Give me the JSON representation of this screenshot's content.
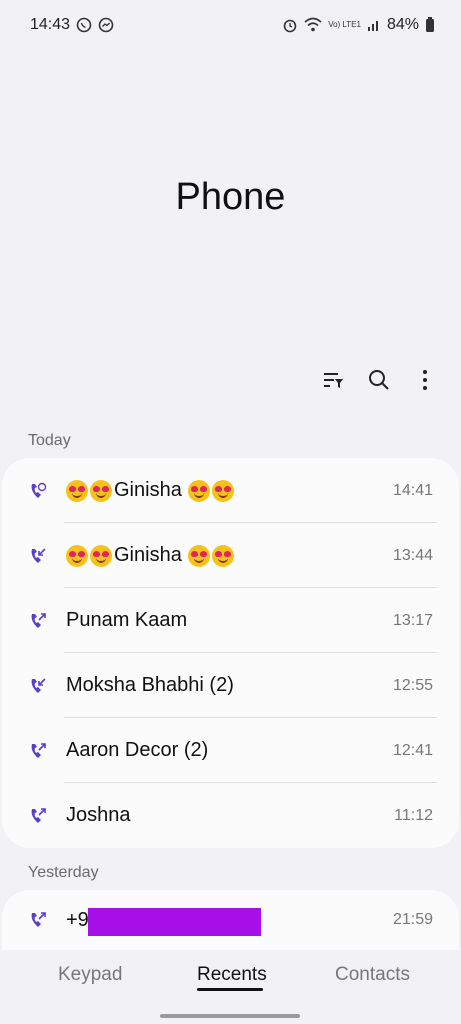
{
  "status_bar": {
    "time": "14:43",
    "battery": "84%",
    "network_label": "Vo) LTE1"
  },
  "header": {
    "title": "Phone"
  },
  "toolbar": {
    "icons": [
      "filter-icon",
      "search-icon",
      "more-options-icon"
    ]
  },
  "sections": [
    {
      "label": "Today",
      "calls": [
        {
          "name": "Ginisha",
          "time": "14:41",
          "type": "video-call",
          "emoji": true
        },
        {
          "name": "Ginisha",
          "time": "13:44",
          "type": "missed",
          "emoji": true
        },
        {
          "name": "Punam Kaam",
          "time": "13:17",
          "type": "outgoing",
          "emoji": false
        },
        {
          "name": "Moksha Bhabhi (2)",
          "time": "12:55",
          "type": "incoming",
          "emoji": false
        },
        {
          "name": "Aaron Decor (2)",
          "time": "12:41",
          "type": "outgoing",
          "emoji": false
        },
        {
          "name": "Joshna",
          "time": "11:12",
          "type": "outgoing",
          "emoji": false
        }
      ]
    },
    {
      "label": "Yesterday",
      "calls": [
        {
          "name": "+9",
          "time": "21:59",
          "type": "outgoing",
          "redacted": true
        }
      ]
    }
  ],
  "bottom_nav": {
    "tabs": [
      "Keypad",
      "Recents",
      "Contacts"
    ],
    "active": "Recents"
  },
  "colors": {
    "accent": "#5b3fc4",
    "redaction": "#a70fe9"
  }
}
